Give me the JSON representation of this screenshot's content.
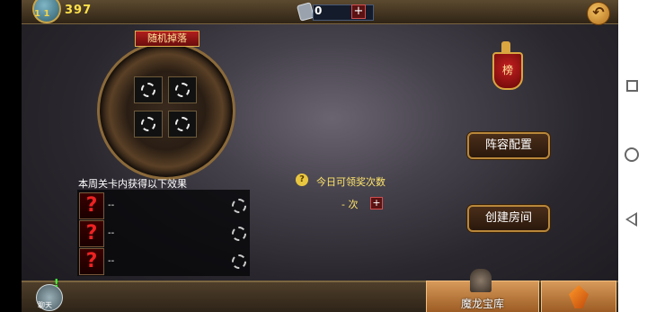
{
  "top_bar": {
    "level_text": "1 1",
    "gold": "397",
    "currency_value": "0",
    "currency_add": "+",
    "back_icon": "back-arrow-icon"
  },
  "drop_panel": {
    "title": "随机掉落",
    "slots": 4
  },
  "effects": {
    "title": "本周关卡内获得以下效果",
    "rows": [
      {
        "icon": "?",
        "text": "--"
      },
      {
        "icon": "?",
        "text": "--"
      },
      {
        "icon": "?",
        "text": "--"
      }
    ]
  },
  "daily_claim": {
    "icon": "?",
    "label": "今日可领奖次数",
    "value": "- 次",
    "add": "+"
  },
  "right_panel": {
    "rank_badge": "榜",
    "lineup_button": "阵容配置",
    "create_room_button": "创建房间"
  },
  "bottom_bar": {
    "chat_alert": "!",
    "chat_label": "聊天",
    "treasury_label": "魔龙宝库"
  }
}
